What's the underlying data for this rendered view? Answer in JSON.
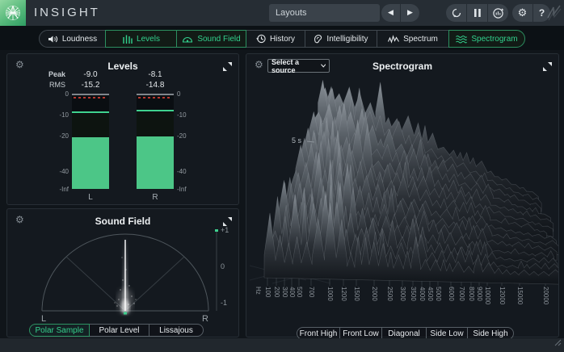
{
  "colors": {
    "accent_green": "#32d18d",
    "meter_green": "#4cc687",
    "clip_red": "#b8382e",
    "panel_bg": "#14191f",
    "topbar_bg": "#262d34"
  },
  "topbar": {
    "app_title": "INSIGHT",
    "layouts_label": "Layouts",
    "prev_arrow": "◀",
    "next_arrow": "▶",
    "help_label": "?",
    "settings_glyph": "⚙"
  },
  "tabs": [
    {
      "label": "Loudness",
      "active": false
    },
    {
      "label": "Levels",
      "active": true
    },
    {
      "label": "Sound Field",
      "active": true
    },
    {
      "label": "History",
      "active": false
    },
    {
      "label": "Intelligibility",
      "active": false
    },
    {
      "label": "Spectrum",
      "active": false
    },
    {
      "label": "Spectrogram",
      "active": true
    }
  ],
  "levels_panel": {
    "title": "Levels",
    "peak_label": "Peak",
    "rms_label": "RMS",
    "settings_glyph": "⚙",
    "meters": [
      {
        "channel": "L",
        "peak": "-9.0",
        "rms": "-15.2",
        "peak_db": -9.0,
        "fill_db": -21.0
      },
      {
        "channel": "R",
        "peak": "-8.1",
        "rms": "-14.8",
        "peak_db": -8.1,
        "fill_db": -20.5
      }
    ],
    "scale": [
      {
        "label": "0",
        "db": 0
      },
      {
        "label": "-10",
        "db": -10
      },
      {
        "label": "-20",
        "db": -20
      },
      {
        "label": "-40",
        "db": -40
      },
      {
        "label": "-Inf",
        "db": null
      }
    ]
  },
  "soundfield_panel": {
    "title": "Sound Field",
    "settings_glyph": "⚙",
    "left_label": "L",
    "right_label": "R",
    "correlation_ticks": [
      "+1",
      "0",
      "-1"
    ],
    "buttons": [
      {
        "label": "Polar Sample",
        "active": true
      },
      {
        "label": "Polar Level",
        "active": false
      },
      {
        "label": "Lissajous",
        "active": false
      }
    ]
  },
  "spectrogram_panel": {
    "title": "Spectrogram",
    "settings_glyph": "⚙",
    "source_selector": "Select a source",
    "time_label": "5 s",
    "freq_labels": [
      "Hz",
      "100",
      "200",
      "300",
      "400",
      "500",
      "700",
      "1000",
      "1200",
      "1500",
      "2000",
      "2500",
      "3000",
      "3500",
      "4000",
      "4500",
      "5000",
      "6000",
      "7000",
      "8000",
      "9000",
      "10000",
      "12000",
      "15000",
      "20000"
    ],
    "buttons": [
      {
        "label": "Front High",
        "active": false
      },
      {
        "label": "Front Low",
        "active": false
      },
      {
        "label": "Diagonal",
        "active": false
      },
      {
        "label": "Side Low",
        "active": false
      },
      {
        "label": "Side High",
        "active": false
      }
    ]
  }
}
